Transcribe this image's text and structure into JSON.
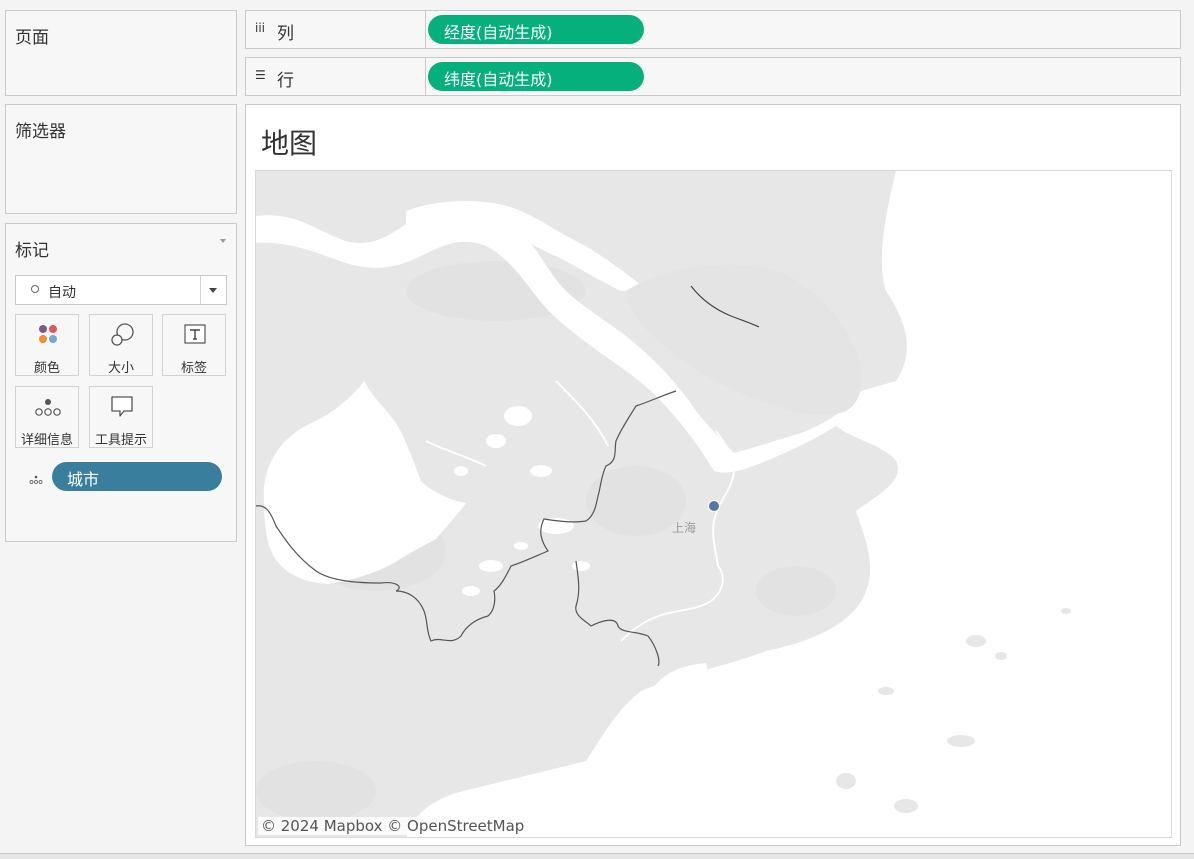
{
  "pages_card": {
    "title": "页面"
  },
  "filters_card": {
    "title": "筛选器"
  },
  "marks_card": {
    "title": "标记",
    "mark_type": "自动",
    "buttons": [
      "颜色",
      "大小",
      "标签",
      "详细信息",
      "工具提示"
    ],
    "detail_field": "城市"
  },
  "columns_shelf": {
    "label": "列",
    "icon": "columns-icon",
    "pill": "经度(自动生成)"
  },
  "rows_shelf": {
    "label": "行",
    "icon": "rows-icon",
    "pill": "纬度(自动生成)"
  },
  "view": {
    "title": "地图",
    "city_label": "上海",
    "attribution": "© 2024 Mapbox © OpenStreetMap"
  },
  "colors": {
    "pill_green": "#06b07c",
    "pill_blue": "#3a7e9e",
    "land": "#e7e7e7",
    "water": "#ffffff",
    "data_point": "#4e79a7"
  }
}
